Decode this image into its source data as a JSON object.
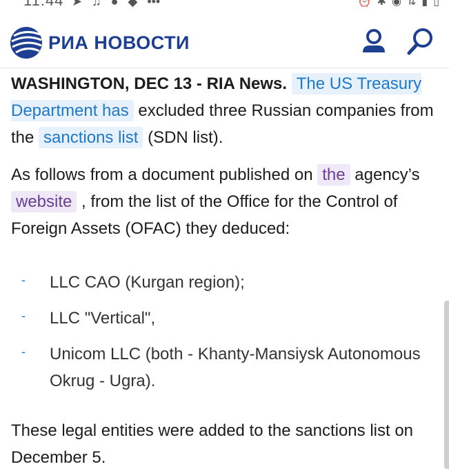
{
  "status_bar": {
    "time": "11:44"
  },
  "header": {
    "logo_text": "РИА НОВОСТИ"
  },
  "article": {
    "lead": "WASHINGTON, DEC 13 - RIA News.",
    "link_treasury": "The US Treasury Department has",
    "p1_text_a": " excluded three Russian companies from the ",
    "link_sanctions": "sanctions list",
    "p1_text_b": " (SDN list).",
    "p2_text_a": "As follows from a document published on ",
    "link_the": "the",
    "p2_text_b": " agency’s ",
    "link_website": "website",
    "p2_text_c": " , from the list of the Office for the Control of Foreign Assets (OFAC) they deduced:",
    "list": [
      {
        "dash": "-",
        "text": "LLC CAO (Kurgan region);"
      },
      {
        "dash": "-",
        "text": "LLC \"Vertical\","
      },
      {
        "dash": "-",
        "text": "Unicom LLC (both - Khanty-Mansiysk Autonomous Okrug - Ugra)."
      }
    ],
    "p3": "These legal entities were added to the sanctions list on December 5."
  },
  "colors": {
    "brand": "#1d3f91",
    "link": "#2079c8",
    "visited_link": "#6a3e96"
  },
  "icons": [
    "ria-globe-logo-icon",
    "user-icon",
    "search-icon"
  ]
}
